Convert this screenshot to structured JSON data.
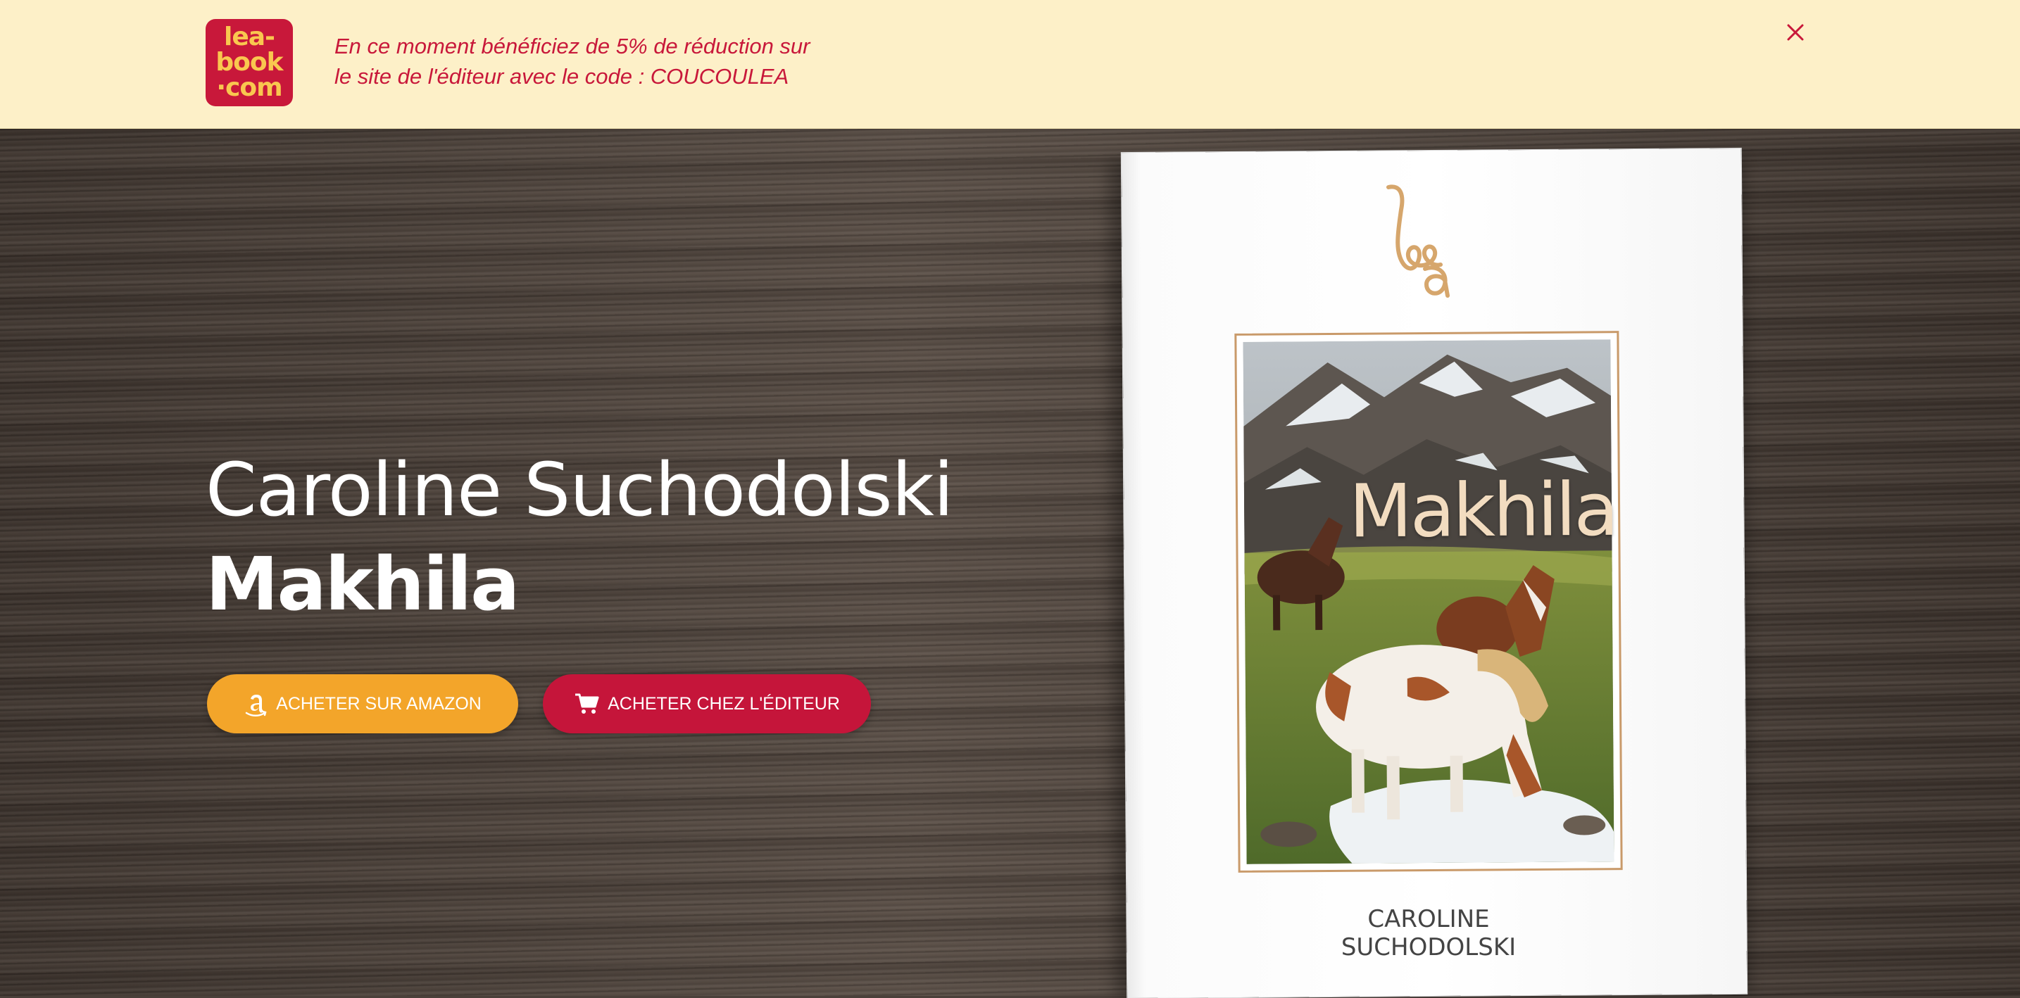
{
  "banner": {
    "logo_lines": [
      "lea-",
      "book",
      "·com"
    ],
    "text_line1": "En ce moment bénéficiez de 5% de réduction sur",
    "text_line2": "le site de l'éditeur avec le code : COUCOULEA",
    "close_icon": "close-icon",
    "color": "#c8183a",
    "background": "#fdf0c8"
  },
  "hero": {
    "author": "Caroline Suchodolski",
    "title": "Makhila",
    "buttons": {
      "amazon": {
        "label": "ACHETER SUR AMAZON",
        "icon": "amazon-icon",
        "color": "#f3a52a"
      },
      "editor": {
        "label": "ACHETER CHEZ L'ÉDITEUR",
        "icon": "cart-icon",
        "color": "#c5153a"
      }
    }
  },
  "book": {
    "publisher_logo": "lea",
    "cover_title": "Makhila",
    "cover_author": "CAROLINE SUCHODOLSKI"
  }
}
